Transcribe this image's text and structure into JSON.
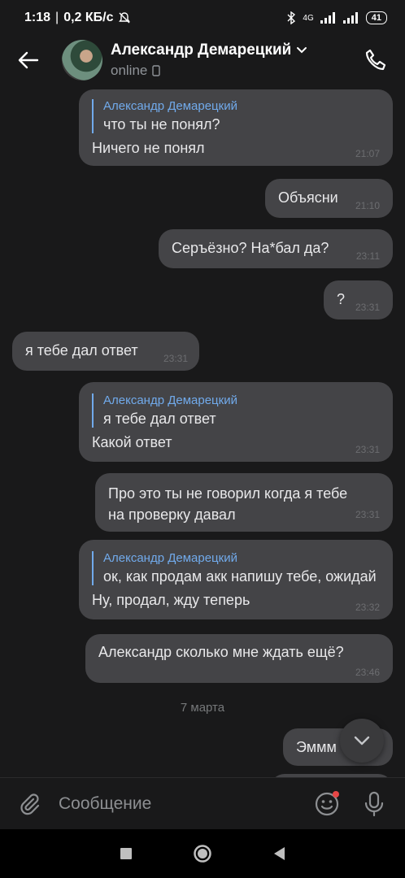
{
  "status": {
    "time": "1:18",
    "speed": "0,2 КБ/с",
    "network": "4G",
    "battery": "41"
  },
  "header": {
    "name": "Александр Демарецкий",
    "status": "online"
  },
  "messages": [
    {
      "quote_name": "Александр Демарецкий",
      "quote_text": "что ты не понял?",
      "text": "Ничего не понял",
      "time": "21:07"
    },
    {
      "text": "Объясни",
      "time": "21:10"
    },
    {
      "text": "Серъёзно? На*бал да?",
      "time": "23:11"
    },
    {
      "text": "?",
      "time": "23:31"
    },
    {
      "text": "я тебе дал ответ",
      "time": "23:31"
    },
    {
      "quote_name": "Александр Демарецкий",
      "quote_text": "я тебе дал ответ",
      "text": "Какой ответ",
      "time": "23:31"
    },
    {
      "text_line1": "Про это ты не говорил когда я тебе",
      "text_line2": "на проверку давал",
      "time": "23:31"
    },
    {
      "quote_name": "Александр Демарецкий",
      "quote_text": "ок, как продам акк напишу тебе, ожидай",
      "text": "Ну, продал, жду теперь",
      "time": "23:32"
    },
    {
      "text": "Александр сколько мне ждать ещё?",
      "time": "23:46"
    },
    {
      "text": "Эммм"
    }
  ],
  "day_separator": "7 марта",
  "composer": {
    "placeholder": "Сообщение"
  },
  "colors": {
    "background": "#19191a",
    "bubble": "#444447",
    "accent": "#71aaeb"
  }
}
